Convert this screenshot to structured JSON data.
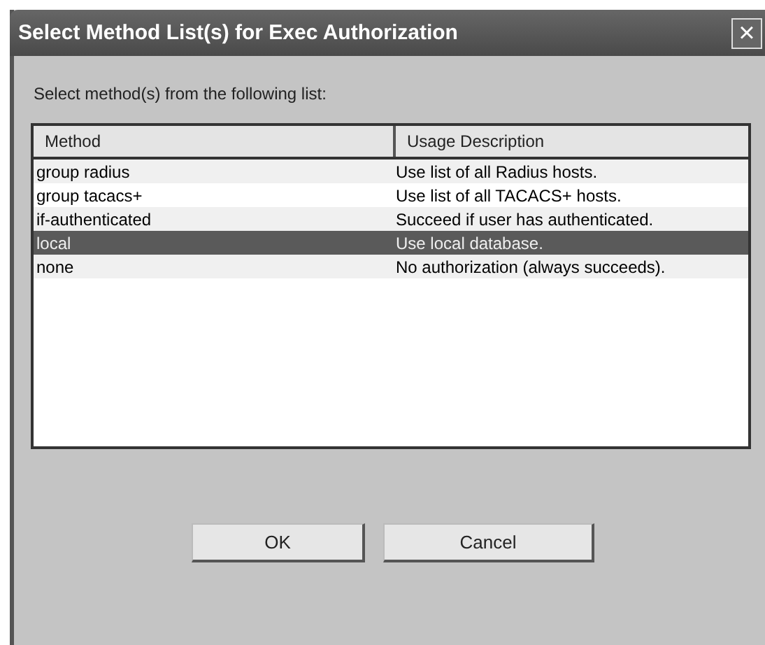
{
  "window": {
    "title": "Select Method List(s) for Exec Authorization",
    "close": "×"
  },
  "instruction": "Select method(s) from the following list:",
  "table": {
    "columns": [
      "Method",
      "Usage Description"
    ],
    "rows": [
      {
        "method": "group radius",
        "description": "Use list of all Radius hosts.",
        "selected": false
      },
      {
        "method": "group tacacs+",
        "description": "Use list of all TACACS+ hosts.",
        "selected": false
      },
      {
        "method": "if-authenticated",
        "description": "Succeed if user has authenticated.",
        "selected": false
      },
      {
        "method": "local",
        "description": "Use local database.",
        "selected": true
      },
      {
        "method": "none",
        "description": "No authorization (always succeeds).",
        "selected": false
      }
    ]
  },
  "buttons": [
    "OK",
    "Cancel"
  ]
}
